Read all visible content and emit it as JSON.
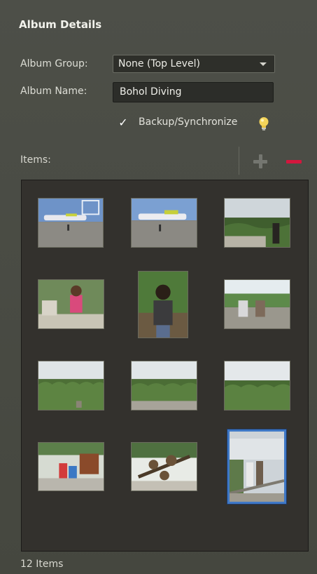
{
  "panel": {
    "title": "Album Details"
  },
  "album_group": {
    "label": "Album Group:",
    "value": "None (Top Level)"
  },
  "album_name": {
    "label": "Album Name:",
    "value": "Bohol Diving"
  },
  "backup": {
    "label": "Backup/Synchronize",
    "checked": true,
    "check_glyph": "✓"
  },
  "items": {
    "label": "Items:",
    "count_label": "12 Items",
    "photos": [
      {
        "subject": "airport tarmac with airplane",
        "icon": "photo-thumbnail"
      },
      {
        "subject": "airplane on tarmac",
        "icon": "photo-thumbnail"
      },
      {
        "subject": "woman at hill viewpoint",
        "icon": "photo-thumbnail"
      },
      {
        "subject": "woman seated at table",
        "icon": "photo-thumbnail"
      },
      {
        "subject": "woman portrait in greenery",
        "icon": "photo-thumbnail"
      },
      {
        "subject": "two people seated on wall",
        "icon": "photo-thumbnail"
      },
      {
        "subject": "chocolate hills landscape",
        "icon": "photo-thumbnail"
      },
      {
        "subject": "chocolate hills from viewpoint",
        "icon": "photo-thumbnail"
      },
      {
        "subject": "chocolate hills panorama",
        "icon": "photo-thumbnail"
      },
      {
        "subject": "parrots on perch",
        "icon": "photo-thumbnail"
      },
      {
        "subject": "tarsiers on branch",
        "icon": "photo-thumbnail"
      },
      {
        "subject": "couple at railing",
        "icon": "photo-thumbnail",
        "selected": true
      }
    ]
  },
  "icons": {
    "dropdown": "chevron-down-icon",
    "tip": "lightbulb-icon",
    "add": "plus-icon",
    "remove": "minus-icon"
  },
  "colors": {
    "panel_bg": "#484a43",
    "grid_bg": "#33312d",
    "selection": "#3f78c6",
    "remove_red": "#d3163d",
    "bulb_yellow": "#f3d45a"
  }
}
